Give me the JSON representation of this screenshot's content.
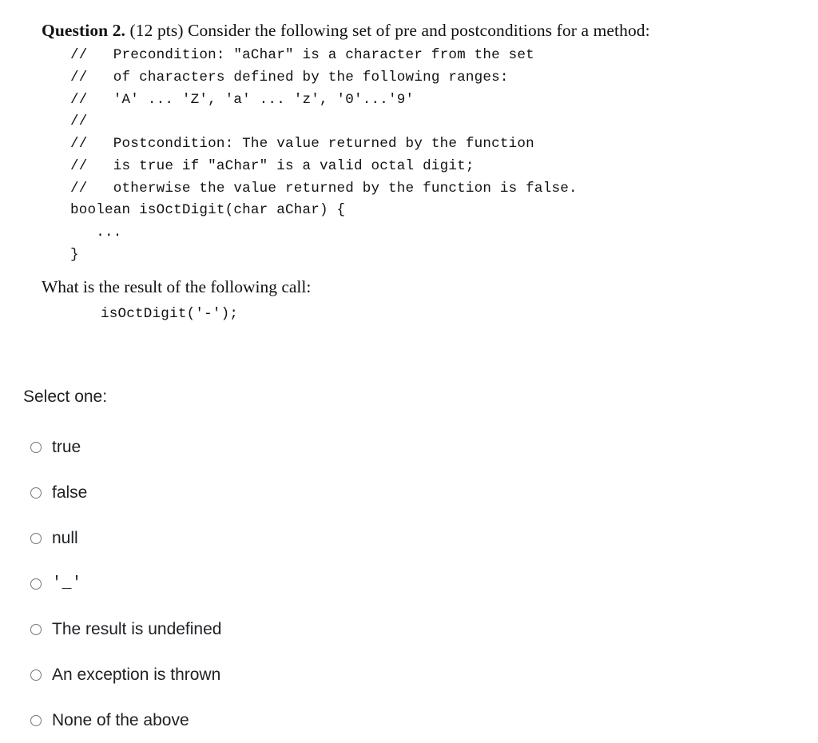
{
  "question": {
    "label": "Question 2.",
    "points": "(12 pts)",
    "stem_text": "Consider the following set of pre and postconditions for a method:",
    "code_lines": [
      "//   Precondition: \"aChar\" is a character from the set",
      "//   of characters defined by the following ranges:",
      "//   'A' ... 'Z', 'a' ... 'z', '0'...'9'",
      "//",
      "//   Postcondition: The value returned by the function",
      "//   is true if \"aChar\" is a valid octal digit;",
      "//   otherwise the value returned by the function is false.",
      "boolean isOctDigit(char aChar) {",
      "   ...",
      "}"
    ],
    "followup_text": "What is the result of the following call:",
    "call_code": "isOctDigit('-');"
  },
  "answer_area": {
    "prompt": "Select one:",
    "options": [
      {
        "id": "opt-true",
        "label": "true",
        "mono": false,
        "selected": false
      },
      {
        "id": "opt-false",
        "label": "false",
        "mono": false,
        "selected": false
      },
      {
        "id": "opt-null",
        "label": "null",
        "mono": false,
        "selected": false
      },
      {
        "id": "opt-underscore",
        "label": "'_'",
        "mono": true,
        "selected": false
      },
      {
        "id": "opt-undefined",
        "label": "The result is undefined",
        "mono": false,
        "selected": false
      },
      {
        "id": "opt-exception",
        "label": "An exception is thrown",
        "mono": false,
        "selected": false
      },
      {
        "id": "opt-none",
        "label": "None of the above",
        "mono": false,
        "selected": false
      }
    ]
  },
  "colors": {
    "background": "#ffffff",
    "text": "#1d2125",
    "question_text": "#111111",
    "radio_border": "#767676"
  }
}
